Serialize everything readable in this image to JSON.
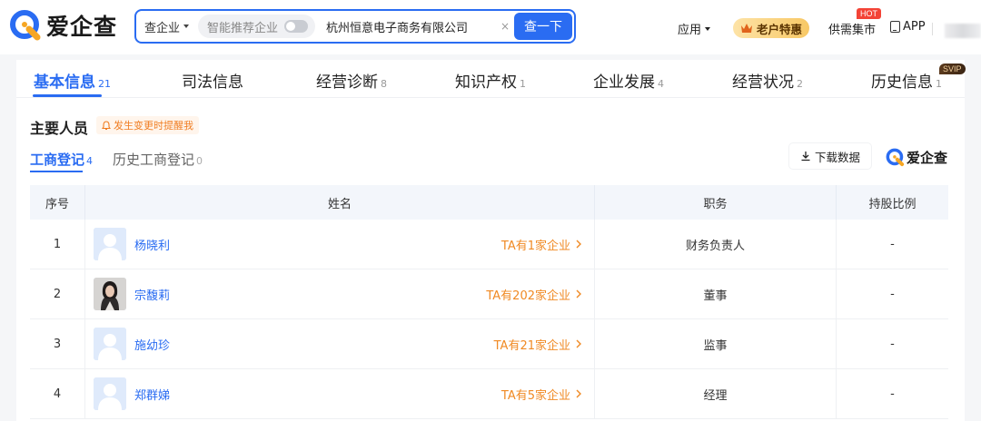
{
  "header": {
    "logo_text": "爱企查",
    "search_type": "查企业",
    "smart_label": "智能推荐企业",
    "search_value": "杭州恒意电子商务有限公司",
    "clear": "×",
    "search_button": "查一下",
    "apps_label": "应用",
    "vip_label": "老户特惠",
    "supply_label": "供需集市",
    "hot_badge": "HOT",
    "app_label": "APP"
  },
  "main_tabs": [
    {
      "label": "基本信息",
      "count": "21"
    },
    {
      "label": "司法信息",
      "count": ""
    },
    {
      "label": "经营诊断",
      "count": "8"
    },
    {
      "label": "知识产权",
      "count": "1"
    },
    {
      "label": "企业发展",
      "count": "4"
    },
    {
      "label": "经营状况",
      "count": "2"
    },
    {
      "label": "历史信息",
      "count": "1"
    }
  ],
  "svip_badge": "SVIP",
  "section": {
    "title": "主要人员",
    "remind": "发生变更时提醒我",
    "sub_tabs": [
      {
        "label": "工商登记",
        "count": "4"
      },
      {
        "label": "历史工商登记",
        "count": "0"
      }
    ],
    "download_label": "下载数据",
    "mini_logo_text": "爱企查"
  },
  "table": {
    "headers": [
      "序号",
      "姓名",
      "职务",
      "持股比例"
    ],
    "rows": [
      {
        "index": "1",
        "name": "杨晓利",
        "link": "TA有1家企业",
        "role": "财务负责人",
        "share": "-",
        "avatar": "default"
      },
      {
        "index": "2",
        "name": "宗馥莉",
        "link": "TA有202家企业",
        "role": "董事",
        "share": "-",
        "avatar": "photo"
      },
      {
        "index": "3",
        "name": "施幼珍",
        "link": "TA有21家企业",
        "role": "监事",
        "share": "-",
        "avatar": "default"
      },
      {
        "index": "4",
        "name": "郑群娣",
        "link": "TA有5家企业",
        "role": "经理",
        "share": "-",
        "avatar": "default"
      }
    ]
  },
  "colors": {
    "brand_blue": "#2a6cf2",
    "link_orange": "#f08a24",
    "hot_red": "#f34336"
  },
  "icons": [
    "logo-q-icon",
    "caret-down-icon",
    "toggle-switch",
    "clear-icon",
    "crown-icon",
    "phone-icon",
    "bell-icon",
    "download-icon",
    "chevron-right-icon",
    "default-avatar-icon"
  ]
}
